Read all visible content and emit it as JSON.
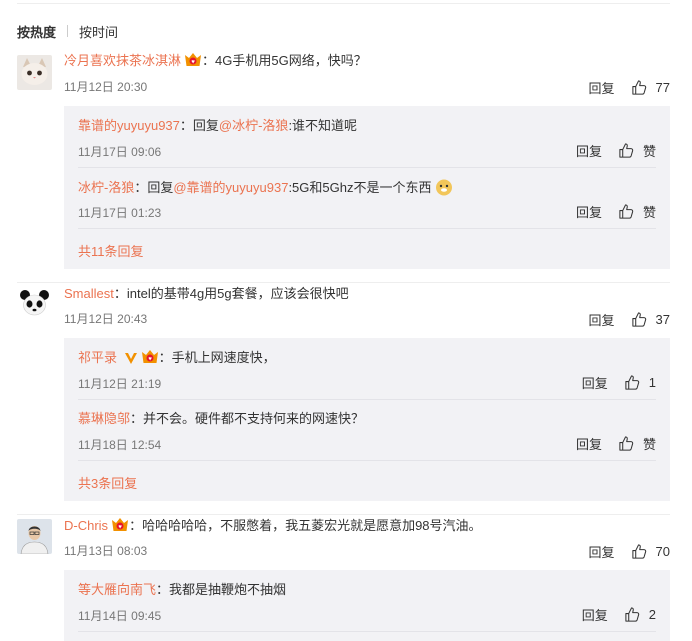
{
  "sort": {
    "hot": "按热度",
    "time": "按时间"
  },
  "labels": {
    "reply": "回复",
    "like": "赞"
  },
  "colors": {
    "name": "#eb7350",
    "box": "#f2f2f5",
    "time": "#777777"
  },
  "comments": [
    {
      "user": "冷月喜欢抹茶冰淇淋",
      "text": "：4G手机用5G网络，快吗？",
      "time": "11月12日 20:30",
      "likes": "77",
      "replies": [
        {
          "user": "靠谱的yuyuyu937",
          "text1": "：回复",
          "mention": "@冰柠-洛狼",
          "text2": ":谁不知道呢",
          "time": "11月17日 09:06",
          "likes": "赞"
        },
        {
          "user": "冰柠-洛狼",
          "text1": "：回复",
          "mention": "@靠谱的yuyuyu937",
          "text2": ":5G和5Ghz不是一个东西",
          "time": "11月17日 01:23",
          "likes": "赞"
        }
      ],
      "more": "共11条回复"
    },
    {
      "user": "Smallest",
      "text": "：intel的基带4g用5g套餐，应该会很快吧",
      "time": "11月12日 20:43",
      "likes": "37",
      "replies": [
        {
          "user": "祁平录",
          "text1": "：手机上网速度快，",
          "time": "11月12日 21:19",
          "likes": "1"
        },
        {
          "user": "慕琳隐邬",
          "text1": "：并不会。硬件都不支持何来的网速快？",
          "time": "11月18日 12:54",
          "likes": "赞"
        }
      ],
      "more": "共3条回复"
    },
    {
      "user": "D-Chris",
      "text": "：哈哈哈哈哈，不服憋着，我五菱宏光就是愿意加98号汽油。",
      "time": "11月13日 08:03",
      "likes": "70",
      "replies": [
        {
          "user": "等大雁向南飞",
          "text1": "：我都是抽鞭炮不抽烟",
          "time": "11月14日 09:45",
          "likes": "2"
        }
      ]
    }
  ]
}
